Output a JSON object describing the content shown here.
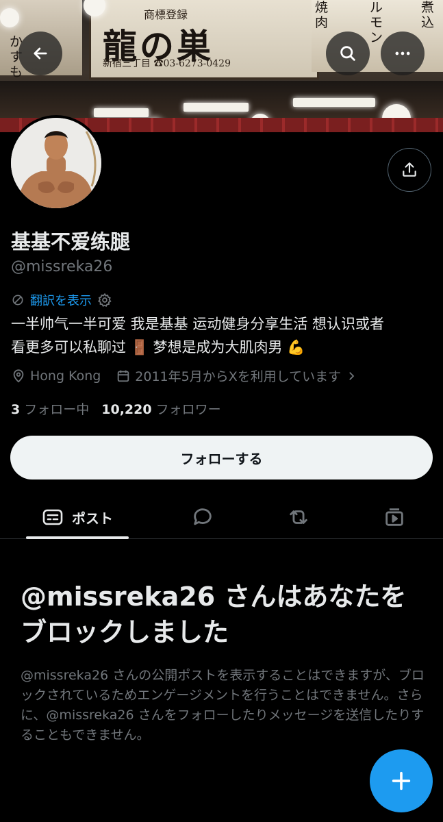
{
  "banner": {
    "sign_title": "龍の巣",
    "sign_top": "商標登録",
    "sign_bottom": "新宿三丁目  ☎03-6273-0429",
    "left_vertical": "かすもつ鍋",
    "right_vertical_1": "焼肉",
    "right_vertical_2": "ルモン",
    "right_vertical_3": "煮込"
  },
  "header": {
    "back_icon": "arrow-left-icon",
    "search_icon": "search-icon",
    "more_icon": "more-horizontal-icon"
  },
  "profile": {
    "display_name": "基基不爱练腿",
    "handle": "@missreka26",
    "translate_label": "翻訳を表示",
    "bio_line1": "一半帅气一半可爱 我是基基 运动健身分享生活 想认识或者",
    "bio_line2": "看更多可以私聊过 🚪 梦想是成为大肌肉男 💪",
    "location": "Hong Kong",
    "joined": "2011年5月からXを利用しています",
    "following_count": "3",
    "following_label": "フォロー中",
    "followers_count": "10,220",
    "followers_label": "フォロワー"
  },
  "actions": {
    "follow_button": "フォローする",
    "share_icon": "share-icon"
  },
  "tabs": {
    "posts_label": "ポスト",
    "icons": [
      "posts-icon",
      "reply-icon",
      "repost-icon",
      "media-icon"
    ]
  },
  "blocked": {
    "title": "@missreka26 さんはあなたをブロックしました",
    "description": "@missreka26 さんの公開ポストを表示することはできますが、ブロックされているためエンゲージメントを行うことはできません。さらに、@missreka26 さんをフォローしたりメッセージを送信したりすることもできません。"
  },
  "colors": {
    "accent": "#1d9bf0",
    "background": "#000000",
    "text_primary": "#e7e9ea",
    "text_secondary": "#71767b"
  }
}
